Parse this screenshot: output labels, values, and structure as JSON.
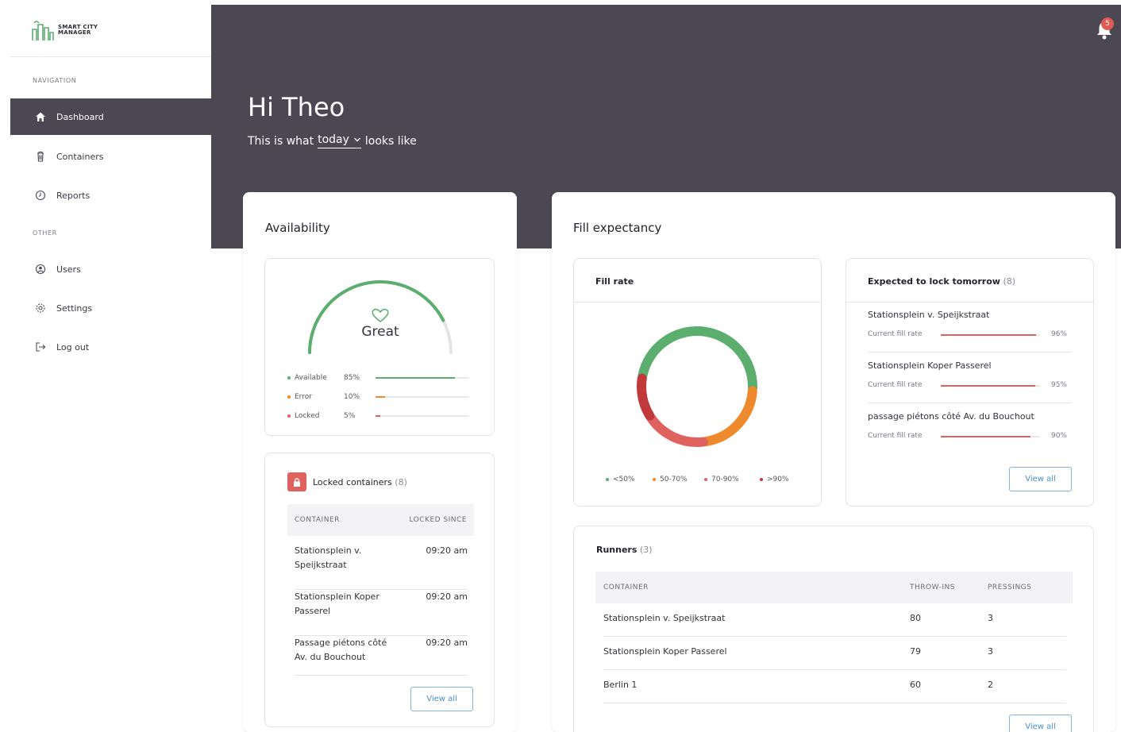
{
  "app": {
    "logo_text": "SMART CITY MANAGER",
    "notification_count": "5"
  },
  "sidebar": {
    "nav_heading": "NAVIGATION",
    "other_heading": "OTHER",
    "items": [
      {
        "label": "Dashboard",
        "icon": "home-icon"
      },
      {
        "label": "Containers",
        "icon": "trash-icon"
      },
      {
        "label": "Reports",
        "icon": "clock-icon"
      },
      {
        "label": "Users",
        "icon": "user-circle-icon"
      },
      {
        "label": "Settings",
        "icon": "gear-icon"
      },
      {
        "label": "Log out",
        "icon": "logout-icon"
      }
    ]
  },
  "header": {
    "greeting": "Hi Theo",
    "subtitle_before": "This is what",
    "period": "today",
    "subtitle_after": "looks like"
  },
  "availability": {
    "title": "Availability",
    "status": "Great",
    "gauge_fraction": 0.85,
    "legend": [
      {
        "label": "Available",
        "value": "85%",
        "fraction": 0.85,
        "color": "#5cae6e"
      },
      {
        "label": "Error",
        "value": "10%",
        "fraction": 0.1,
        "color": "#ef8a2c"
      },
      {
        "label": "Locked",
        "value": "5%",
        "fraction": 0.05,
        "color": "#e0625f"
      }
    ]
  },
  "locked": {
    "title": "Locked containers",
    "count": "(8)",
    "col_container": "CONTAINER",
    "col_since": "LOCKED SINCE",
    "rows": [
      {
        "line1": "Stationsplein v.",
        "line2": "Speijkstraat",
        "since": "09:20 am"
      },
      {
        "line1": "Stationsplein Koper",
        "line2": "Passerel",
        "since": "09:20 am"
      },
      {
        "line1": "Passage piétons côté",
        "line2": "Av. du Bouchout",
        "since": "09:20 am"
      }
    ],
    "view_all": "View all"
  },
  "fill_expectancy": {
    "title": "Fill expectancy",
    "fill_rate_title": "Fill rate",
    "legend": [
      {
        "label": "<50%",
        "color": "#5cae6e"
      },
      {
        "label": "50-70%",
        "color": "#ef8a2c"
      },
      {
        "label": "70-90%",
        "color": "#e0625f"
      },
      {
        "label": ">90%",
        "color": "#c0393b"
      }
    ],
    "expected_title": "Expected to lock tomorrow",
    "expected_count": "(8)",
    "expected": [
      {
        "name": "Stationsplein v. Speijkstraat",
        "label": "Current fill rate",
        "value": "96%",
        "fraction": 0.96
      },
      {
        "name": "Stationsplein Koper Passerel",
        "label": "Current fill rate",
        "value": "95%",
        "fraction": 0.95
      },
      {
        "name": "passage piétons côté Av. du Bouchout",
        "label": "Current fill rate",
        "value": "90%",
        "fraction": 0.9
      }
    ],
    "view_all": "View all"
  },
  "runners": {
    "title": "Runners",
    "count": "(3)",
    "col_container": "CONTAINER",
    "col_throwins": "THROW-INS",
    "col_pressings": "PRESSINGS",
    "rows": [
      {
        "container": "Stationsplein v. Speijkstraat",
        "throwins": "80",
        "pressings": "3"
      },
      {
        "container": "Stationsplein Koper Passerel",
        "throwins": "79",
        "pressings": "3"
      },
      {
        "container": "Berlin 1",
        "throwins": "60",
        "pressings": "2"
      }
    ],
    "view_all": "View all"
  },
  "chart_data": {
    "type": "pie",
    "categories": [
      "<50%",
      "50-70%",
      "70-90%",
      ">90%"
    ],
    "values": [
      48,
      22,
      18,
      12
    ],
    "colors": [
      "#5cae6e",
      "#ef8a2c",
      "#e0625f",
      "#c0393b"
    ]
  }
}
